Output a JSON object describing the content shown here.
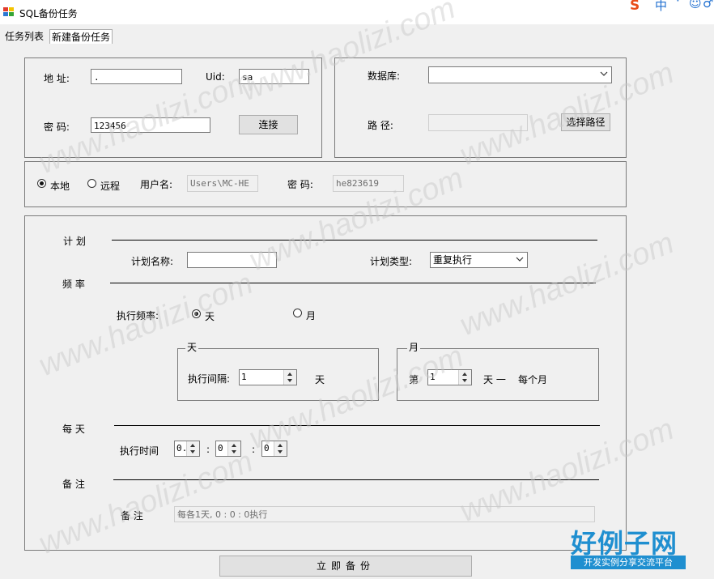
{
  "window": {
    "title": "SQL备份任务",
    "tray": {
      "logo": "S",
      "input_mode": "中",
      "extra": "·",
      "emoji": "☺",
      "settings": "♂"
    }
  },
  "tabs": [
    {
      "label": "任务列表",
      "active": false
    },
    {
      "label": "新建备份任务",
      "active": true
    }
  ],
  "connection": {
    "address_label": "地  址:",
    "address_value": ".",
    "uid_label": "Uid:",
    "uid_value": "sa",
    "password_label": "密  码:",
    "password_value": "123456",
    "connect_button": "连接"
  },
  "database": {
    "database_label": "数据库:",
    "database_value": "",
    "path_label": "路  径:",
    "path_value": "",
    "choose_path_button": "选择路径"
  },
  "location": {
    "local_label": "本地",
    "local_selected": true,
    "remote_label": "远程",
    "remote_selected": false,
    "username_label": "用户名:",
    "username_value": "Users\\MC-HE",
    "password_label": "密  码:",
    "password_value": "he823619"
  },
  "plan": {
    "section_plan": "计  划",
    "plan_name_label": "计划名称:",
    "plan_name_value": "",
    "plan_type_label": "计划类型:",
    "plan_type_value": "重复执行",
    "section_frequency": "频  率",
    "frequency_label": "执行频率:",
    "freq_day_label": "天",
    "freq_day_selected": true,
    "freq_month_label": "月",
    "freq_month_selected": false,
    "day_group_title": "天",
    "interval_label": "执行间隔:",
    "interval_value": "1",
    "interval_unit": "天",
    "month_group_title": "月",
    "month_prefix": "第",
    "month_value": "1",
    "month_suffix": "天 一",
    "month_every": "每个月",
    "section_daily": "每  天",
    "exec_time_label": "执行时间",
    "hour_value": "0.",
    "minute_value": "0",
    "second_value": "0",
    "time_sep1": ":",
    "time_sep2": ":",
    "section_notes": "备  注",
    "notes_label": "备  注",
    "notes_value": "每各1天, 0 : 0 : 0执行"
  },
  "backup_button": "立即备份",
  "watermark": {
    "text": "www.haolizi.com",
    "logo_title": "好例子网",
    "logo_subtitle": "开发实例分享交流平台"
  },
  "colors": {
    "accent": "#1f8fd0",
    "panel": "#f0f0f0",
    "border": "#7a7a7a"
  }
}
